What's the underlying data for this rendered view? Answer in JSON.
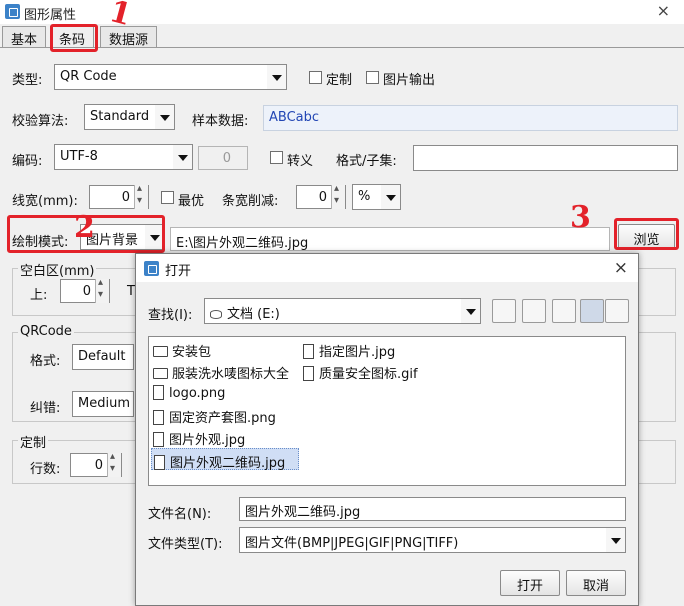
{
  "window": {
    "title": "图形属性",
    "close": "×"
  },
  "tabs": [
    "基本",
    "条码",
    "数据源"
  ],
  "form": {
    "type_label": "类型:",
    "type_value": "QR Code",
    "custom_label": "定制",
    "image_output_label": "图片输出",
    "checksum_label": "校验算法:",
    "checksum_value": "Standard",
    "sample_label": "样本数据:",
    "sample_value": "ABCabc",
    "encoding_label": "编码:",
    "encoding_value": "UTF-8",
    "encoding_num": "0",
    "escape_label": "转义",
    "format_label": "格式/子集:",
    "linewidth_label": "线宽(mm):",
    "linewidth_value": "0",
    "optimal_label": "最优",
    "bar_reduce_label": "条宽削减:",
    "bar_reduce_value": "0",
    "bar_reduce_unit": "%",
    "draw_mode_label": "绘制模式:",
    "draw_mode_value": "图片背景",
    "image_path": "E:\\图片外观二维码.jpg",
    "browse_label": "浏览",
    "blank_area_title": "空白区(mm)",
    "blank_top_label": "上:",
    "blank_top_value": "0",
    "blank_t_label": "T",
    "qrcode_title": "QRCode",
    "qr_format_label": "格式:",
    "qr_format_value": "Default",
    "qr_ecc_label": "纠错:",
    "qr_ecc_value": "Medium",
    "custom_group_title": "定制",
    "rows_label": "行数:",
    "rows_value": "0"
  },
  "annotations": [
    "1",
    "2",
    "3"
  ],
  "dialog": {
    "title": "打开",
    "close": "×",
    "lookin_label": "查找(I):",
    "lookin_value": "文档 (E:)",
    "files_col1": [
      {
        "name": "安装包",
        "kind": "folder"
      },
      {
        "name": "服装洗水唛图标大全",
        "kind": "folder"
      },
      {
        "name": "logo.png",
        "kind": "file"
      },
      {
        "name": "固定资产套图.png",
        "kind": "file"
      },
      {
        "name": "图片外观.jpg",
        "kind": "file"
      },
      {
        "name": "图片外观二维码.jpg",
        "kind": "file",
        "selected": true
      }
    ],
    "files_col2": [
      {
        "name": "指定图片.jpg",
        "kind": "file"
      },
      {
        "name": "质量安全图标.gif",
        "kind": "file"
      }
    ],
    "filename_label": "文件名(N):",
    "filename_value": "图片外观二维码.jpg",
    "filetype_label": "文件类型(T):",
    "filetype_value": "图片文件(BMP|JPEG|GIF|PNG|TIFF)",
    "open_label": "打开",
    "cancel_label": "取消"
  }
}
